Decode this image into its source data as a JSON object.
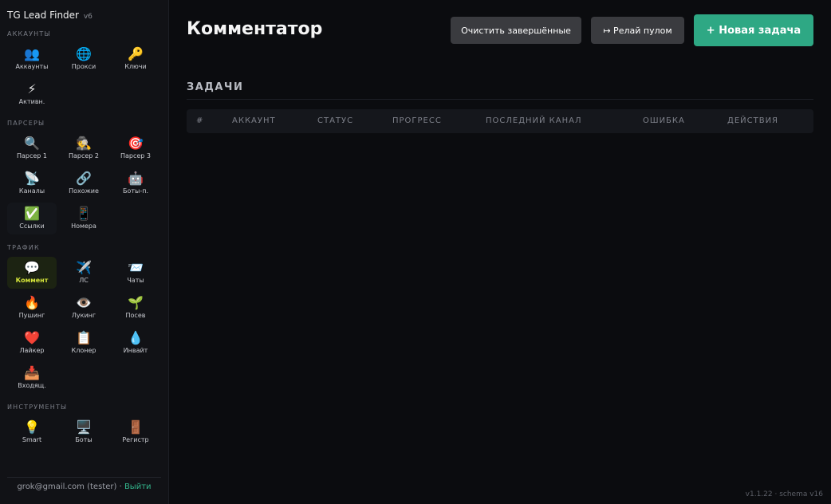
{
  "app": {
    "title": "TG Lead Finder",
    "version": "v6"
  },
  "sidebar": {
    "sections": [
      {
        "title": "АККАУНТЫ",
        "items": [
          {
            "icon": "👥",
            "icon_name": "users-icon",
            "label": "Аккаунты"
          },
          {
            "icon": "🌐",
            "icon_name": "globe-icon",
            "label": "Прокси"
          },
          {
            "icon": "🔑",
            "icon_name": "key-icon",
            "label": "Ключи"
          },
          {
            "icon": "⚡",
            "icon_name": "lightning-icon",
            "label": "Активн."
          }
        ]
      },
      {
        "title": "ПАРСЕРЫ",
        "items": [
          {
            "icon": "🔍",
            "icon_name": "magnifier-icon",
            "label": "Парсер 1"
          },
          {
            "icon": "🕵️",
            "icon_name": "detective-icon",
            "label": "Парсер 2"
          },
          {
            "icon": "🎯",
            "icon_name": "target-icon",
            "label": "Парсер 3"
          },
          {
            "icon": "📡",
            "icon_name": "satellite-icon",
            "label": "Каналы"
          },
          {
            "icon": "🔗",
            "icon_name": "link-icon",
            "label": "Похожие"
          },
          {
            "icon": "🤖",
            "icon_name": "robot-icon",
            "label": "Боты-п."
          },
          {
            "icon": "✅",
            "icon_name": "check-icon",
            "label": "Ссылки"
          },
          {
            "icon": "📱",
            "icon_name": "phone-icon",
            "label": "Номера"
          }
        ]
      },
      {
        "title": "ТРАФИК",
        "items": [
          {
            "icon": "💬",
            "icon_name": "speech-bubble-icon",
            "label": "Коммент"
          },
          {
            "icon": "✈️",
            "icon_name": "plane-icon",
            "label": "ЛС"
          },
          {
            "icon": "📨",
            "icon_name": "envelope-icon",
            "label": "Чаты"
          },
          {
            "icon": "🔥",
            "icon_name": "fire-icon",
            "label": "Пушинг"
          },
          {
            "icon": "👁️",
            "icon_name": "eye-icon",
            "label": "Лукинг"
          },
          {
            "icon": "🌱",
            "icon_name": "seedling-icon",
            "label": "Посев"
          },
          {
            "icon": "❤️",
            "icon_name": "heart-icon",
            "label": "Лайкер"
          },
          {
            "icon": "📋",
            "icon_name": "clipboard-icon",
            "label": "Клонер"
          },
          {
            "icon": "💧",
            "icon_name": "droplet-icon",
            "label": "Инвайт"
          },
          {
            "icon": "📥",
            "icon_name": "inbox-icon",
            "label": "Входящ."
          }
        ]
      },
      {
        "title": "ИНСТРУМЕНТЫ",
        "items": [
          {
            "icon": "💡",
            "icon_name": "lightbulb-icon",
            "label": "Smart"
          },
          {
            "icon": "🖥️",
            "icon_name": "desktop-icon",
            "label": "Боты"
          },
          {
            "icon": "🚪",
            "icon_name": "door-icon",
            "label": "Регистр"
          }
        ]
      }
    ],
    "active_label": "Коммент",
    "highlighted_label": "Ссылки",
    "user": "grok@gmail.com (tester)",
    "separator": "·",
    "logout": "Выйти"
  },
  "main": {
    "title": "Комментатор",
    "buttons": {
      "clear": "Очистить завершённые",
      "relay": "↦ Релай пулом",
      "new_task": "+ Новая задача"
    },
    "tasks_heading": "ЗАДАЧИ",
    "table": {
      "columns": [
        "#",
        "АККАУНТ",
        "СТАТУС",
        "ПРОГРЕСС",
        "ПОСЛЕДНИЙ КАНАЛ",
        "ОШИБКА",
        "ДЕЙСТВИЯ"
      ],
      "rows": []
    }
  },
  "footer": {
    "version": "v1.1.22 · schema v16"
  },
  "colors": {
    "accent": "#2ea884",
    "active_label": "#d2e23a",
    "background": "#0b0c0f",
    "sidebar": "#111216"
  }
}
